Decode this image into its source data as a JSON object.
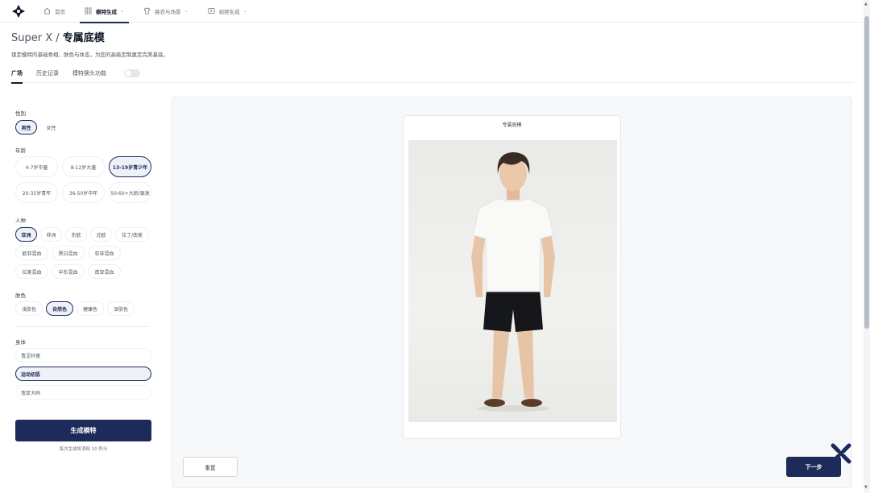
{
  "nav": {
    "items": [
      {
        "label": "首页",
        "icon": "home-icon"
      },
      {
        "label": "模特生成",
        "icon": "grid-icon"
      },
      {
        "label": "换衣与场景",
        "icon": "shirt-icon"
      },
      {
        "label": "视频生成",
        "icon": "video-icon"
      }
    ],
    "chevron": "⌄"
  },
  "header": {
    "title_prefix": "Super X /",
    "title_main": "专属底模",
    "subtitle": "锁定模特的基础骨相、肤色与体态，为您的高级定制奠定完美基底。"
  },
  "tabs": {
    "plaza": "广场",
    "history": "历史记录",
    "face_swap": "模特换头功能",
    "face_swap_enabled": false
  },
  "form": {
    "gender": {
      "label": "性别",
      "options": [
        "男性",
        "女性"
      ],
      "selected": "男性"
    },
    "age": {
      "label": "年龄",
      "options": [
        "4-7岁中童",
        "8-12岁大童",
        "13-19岁青少年",
        "20-35岁青年",
        "36-50岁中年",
        "50-60+大龄/银发"
      ],
      "selected": "13-19岁青少年"
    },
    "ethnicity": {
      "label": "人种",
      "options": [
        "亚洲",
        "非洲",
        "东欧",
        "北欧",
        "拉丁/南美",
        "欧亚混血",
        "黑白混血",
        "亚非混血",
        "拉美混血",
        "中东混血",
        "南亚混血"
      ],
      "selected": "亚洲"
    },
    "skin": {
      "label": "肤色",
      "options": [
        "浅肤色",
        "自然色",
        "健康色",
        "深肤色"
      ],
      "selected": "自然色"
    },
    "body": {
      "label": "身体",
      "options": [
        "青涩纤瘦",
        "运动初肌",
        "宽厚大码"
      ],
      "selected": "运动初肌"
    },
    "generate_button": "生成模特",
    "cost_note": "每次生成将消耗 10 积分"
  },
  "preview": {
    "card_title": "专属底模",
    "image_alt": "Young man in white T-shirt and black shorts standing against light backdrop"
  },
  "actions": {
    "reset": "重置",
    "next": "下一步"
  },
  "colors": {
    "primary": "#1c2b5a",
    "selected_bg": "#eef1f8",
    "canvas_bg": "#f7f8fa"
  }
}
